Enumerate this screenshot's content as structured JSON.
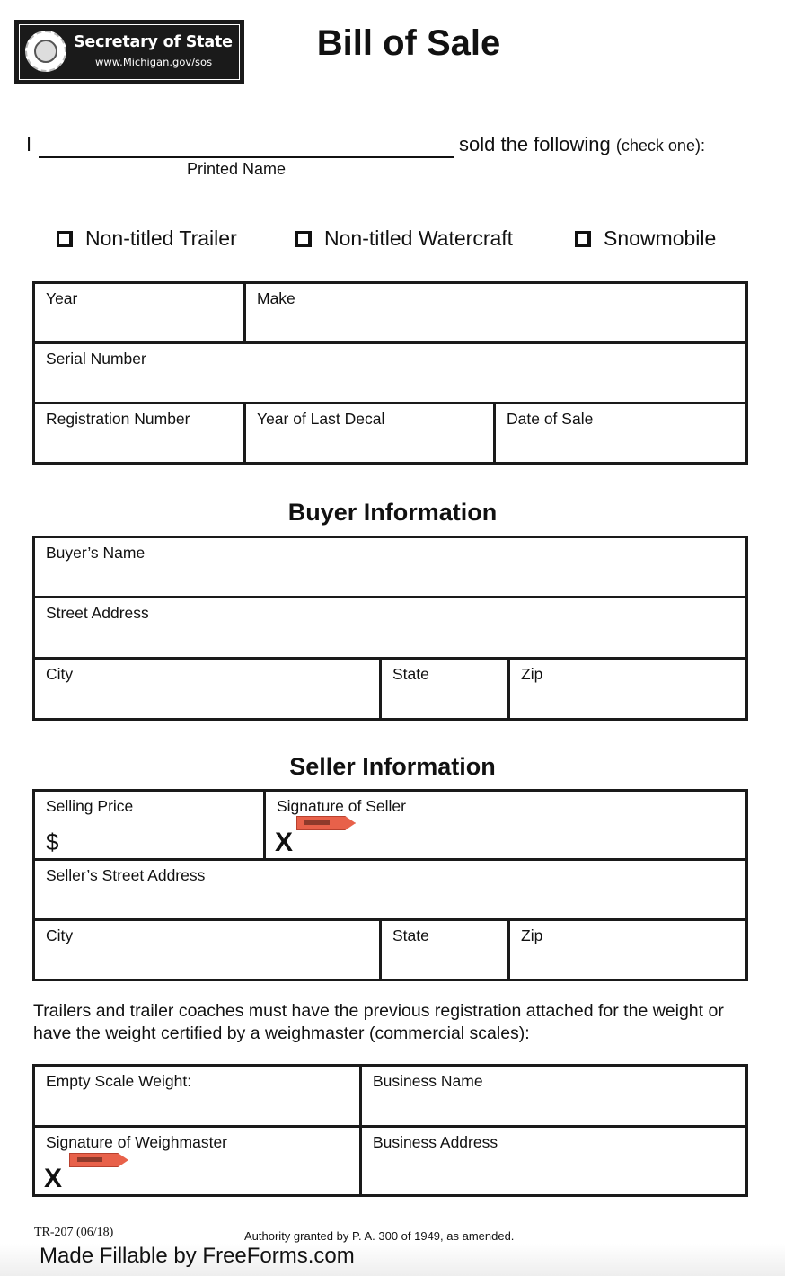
{
  "header": {
    "logo": {
      "title": "Secretary of State",
      "url": "www.Michigan.gov/sos"
    },
    "title": "Bill of Sale"
  },
  "intro": {
    "prefix": "I",
    "suffix": "sold the following",
    "suffix_small": "(check one):",
    "line_caption": "Printed Name"
  },
  "options": [
    {
      "label": "Non-titled Trailer",
      "checked": false
    },
    {
      "label": "Non-titled Watercraft",
      "checked": false
    },
    {
      "label": "Snowmobile",
      "checked": false
    }
  ],
  "vehicle": {
    "year": "Year",
    "make": "Make",
    "serial": "Serial Number",
    "registration": "Registration Number",
    "last_decal": "Year of Last Decal",
    "date_of_sale": "Date of Sale"
  },
  "buyer": {
    "heading": "Buyer Information",
    "name": "Buyer’s Name",
    "street": "Street Address",
    "city": "City",
    "state": "State",
    "zip": "Zip"
  },
  "seller": {
    "heading": "Seller Information",
    "price": "Selling Price",
    "currency": "$",
    "signature": "Signature of Seller",
    "sign_mark": "X",
    "street": "Seller’s Street Address",
    "city": "City",
    "state": "State",
    "zip": "Zip"
  },
  "note": "Trailers and trailer coaches must have the previous registration attached for the weight or have the weight certified by a weighmaster (commercial scales):",
  "weighmaster": {
    "empty_weight": "Empty Scale Weight:",
    "business_name": "Business Name",
    "signature": "Signature of Weighmaster",
    "sign_mark": "X",
    "business_address": "Business Address"
  },
  "footer": {
    "form_code": "TR-207 (06/18)",
    "authority": "Authority granted by P. A. 300 of 1949, as amended.",
    "made_fillable": "Made Fillable by FreeForms.com"
  },
  "colors": {
    "sign_tag": "#e8614a",
    "logo_bg": "#1a1a1a"
  }
}
